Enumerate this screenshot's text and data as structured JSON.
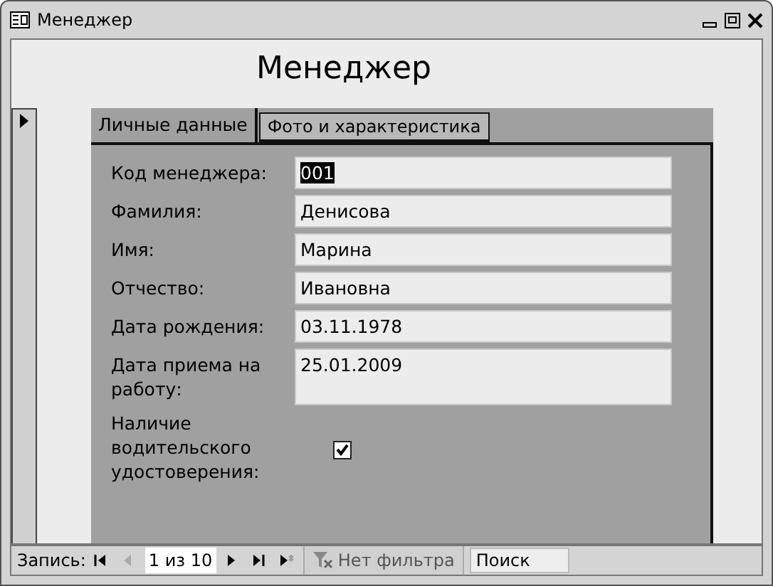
{
  "window": {
    "title": "Менеджер"
  },
  "form_title": "Менеджер",
  "tabs": [
    {
      "label": "Личные данные",
      "selected": true
    },
    {
      "label": "Фото и характеристика",
      "selected": false
    }
  ],
  "fields": [
    {
      "kind": "text",
      "label": "Код менеджера:",
      "value": "001",
      "value_selected": true
    },
    {
      "kind": "text",
      "label": "Фамилия:",
      "value": "Денисова",
      "value_selected": false
    },
    {
      "kind": "text",
      "label": "Имя:",
      "value": "Марина",
      "value_selected": false
    },
    {
      "kind": "text",
      "label": "Отчество:",
      "value": "Ивановна",
      "value_selected": false
    },
    {
      "kind": "text",
      "label": "Дата рождения:",
      "value": "03.11.1978",
      "value_selected": false
    },
    {
      "kind": "memo",
      "label": "Дата приема на работу:",
      "value": "25.01.2009",
      "value_selected": false
    },
    {
      "kind": "checkbox",
      "label": "Наличие водительского удостоверения:",
      "checked": true
    }
  ],
  "record_nav": {
    "label": "Запись:",
    "position": "1 из 10",
    "buttons": [
      {
        "kind": "first",
        "disabled": false
      },
      {
        "kind": "prev",
        "disabled": true
      }
    ],
    "buttons_after": [
      {
        "kind": "next",
        "disabled": false
      },
      {
        "kind": "last",
        "disabled": false
      },
      {
        "kind": "new",
        "disabled": false
      }
    ],
    "filter": "Нет фильтра",
    "search": {
      "placeholder": "Поиск"
    }
  }
}
